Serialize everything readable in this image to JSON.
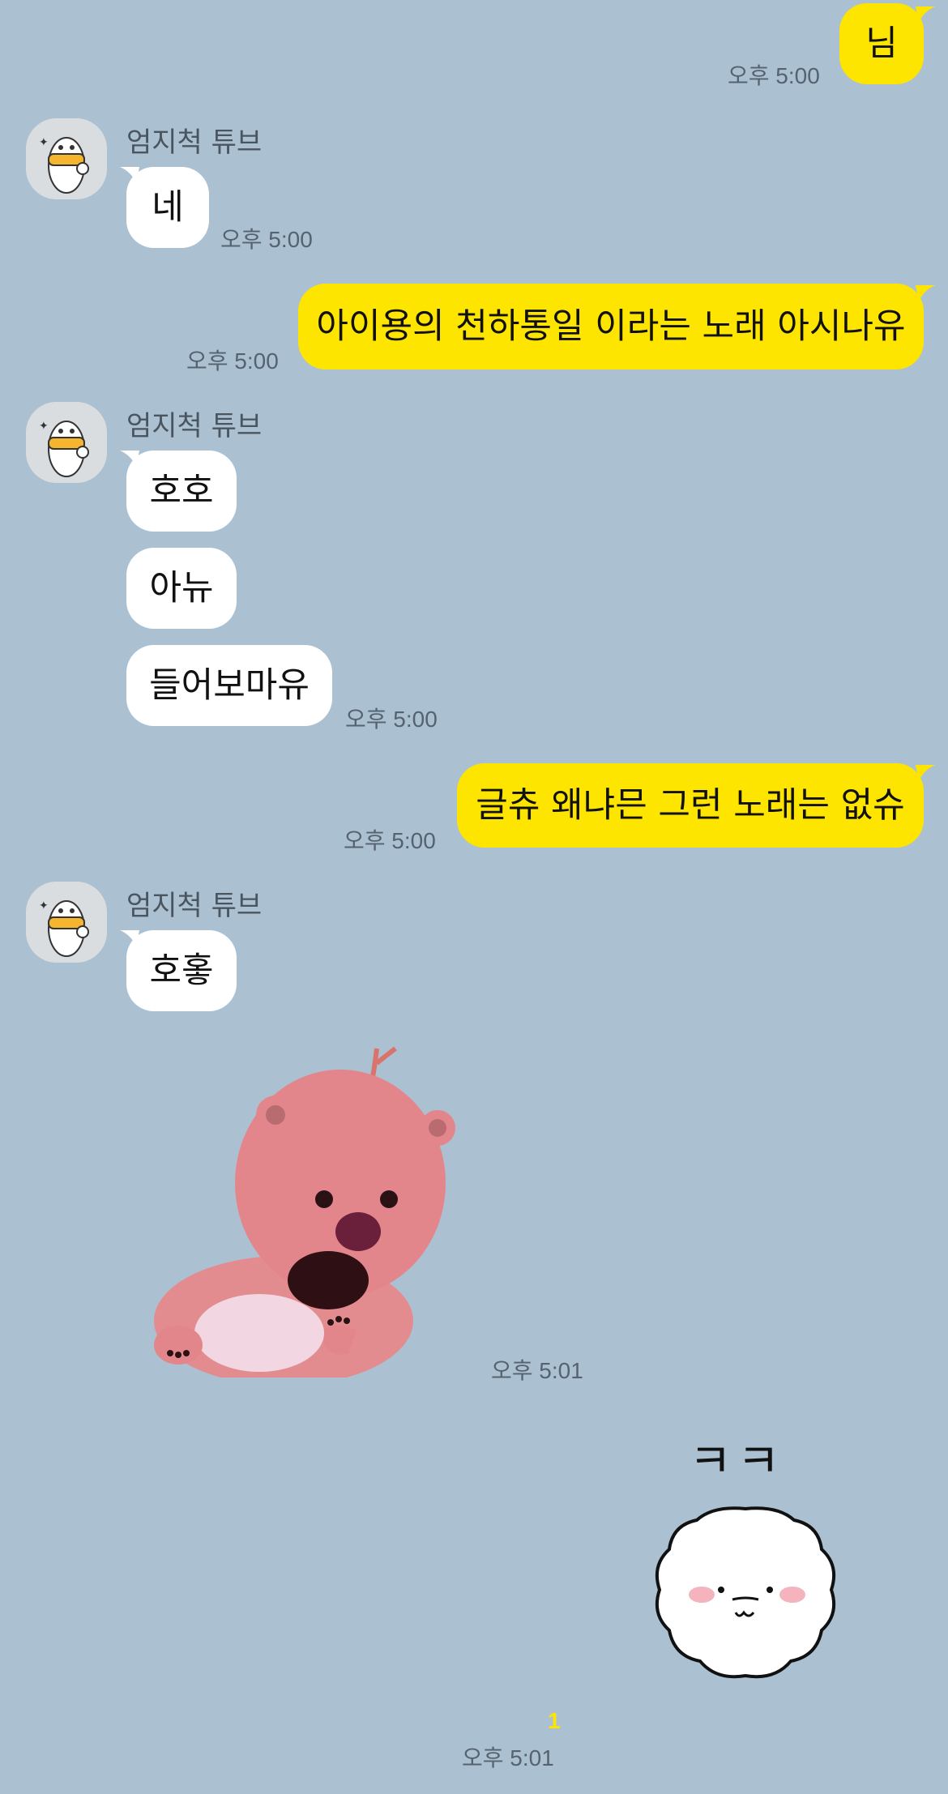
{
  "messages": [
    {
      "text": "님",
      "time": "오후 5:00"
    },
    {
      "sender": "엄지척 튜브",
      "text": "네",
      "time": "오후 5:00"
    },
    {
      "text": "아이용의 천하통일 이라는 노래 아시나유",
      "time": "오후 5:00"
    },
    {
      "sender": "엄지척 튜브",
      "texts": [
        "호호",
        "아뉴",
        "들어보마유"
      ],
      "time": "오후 5:00"
    },
    {
      "text": "글츄 왜냐믄 그런 노래는 없슈",
      "time": "오후 5:00"
    },
    {
      "sender": "엄지척 튜브",
      "text": "호홓"
    },
    {
      "sticker": "pink-beaver-sticker",
      "time": "오후 5:01"
    },
    {
      "sticker_text": "ㅋㅋ",
      "sticker": "white-puppy-sticker",
      "unread": "1",
      "time": "오후 5:01"
    }
  ],
  "colors": {
    "background": "#abc1d1",
    "my_bubble": "#fee500",
    "their_bubble": "#ffffff",
    "unread": "#fee500"
  }
}
